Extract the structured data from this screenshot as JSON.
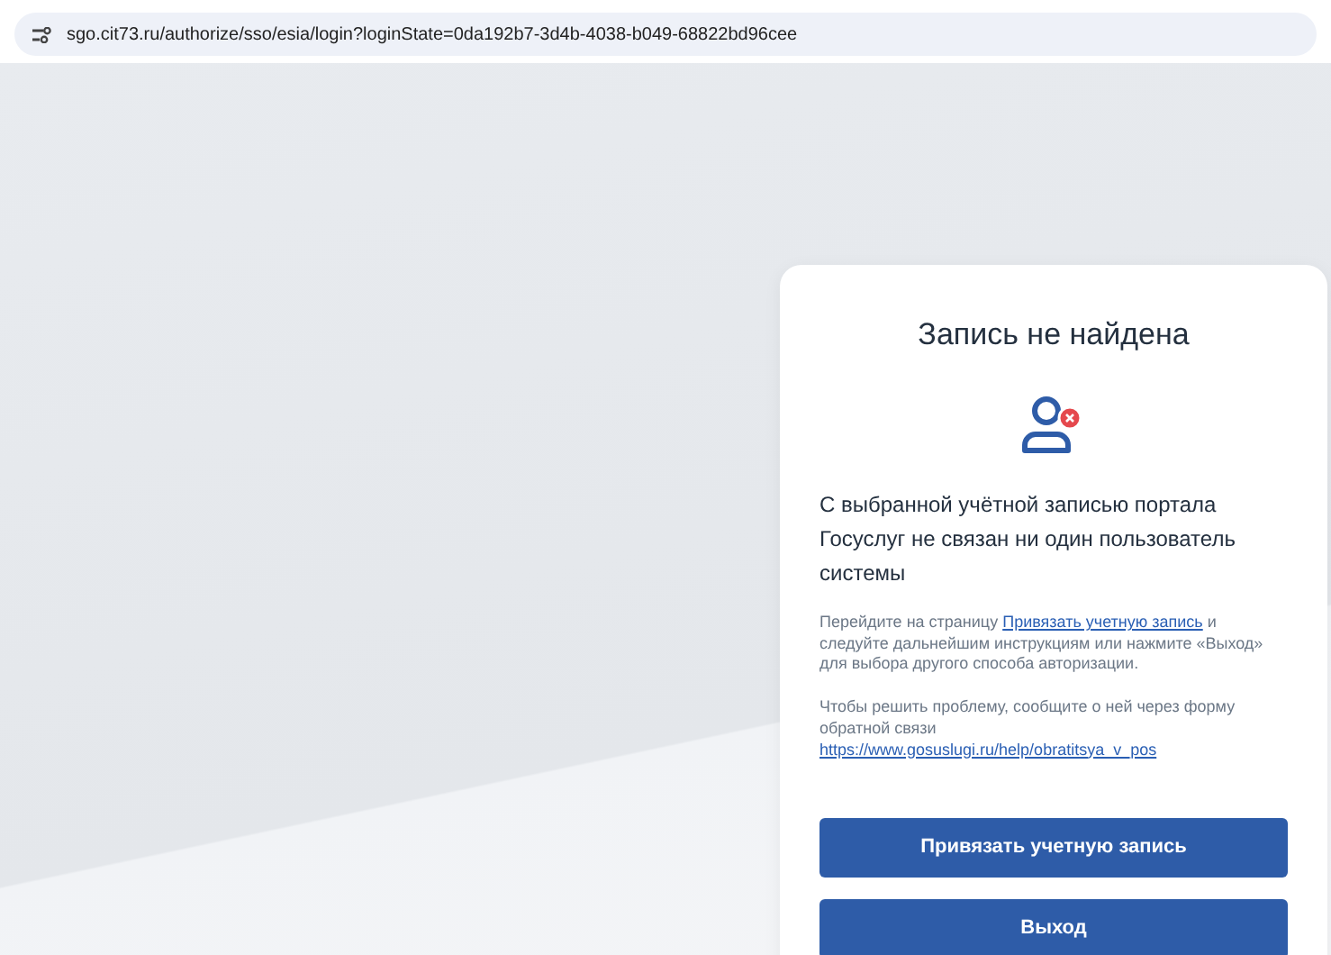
{
  "address_bar": {
    "url": "sgo.cit73.ru/authorize/sso/esia/login?loginState=0da192b7-3d4b-4038-b049-68822bd96cee"
  },
  "dialog": {
    "title": "Запись не найдена",
    "message": "С выбранной учётной записью портала Госуслуг не связан ни один пользователь системы",
    "hint": {
      "before": "Перейдите на страницу",
      "link": "Привязать учетную запись",
      "after": "и следуйте дальнейшим инструкциям или нажмите «Выход» для выбора другого способа авторизации."
    },
    "support": {
      "text": "Чтобы решить проблему, сообщите о ней через форму обратной связи",
      "link": "https://www.gosuslugi.ru/help/obratitsya_v_pos"
    },
    "buttons": [
      "Привязать учетную запись",
      "Выход"
    ]
  }
}
